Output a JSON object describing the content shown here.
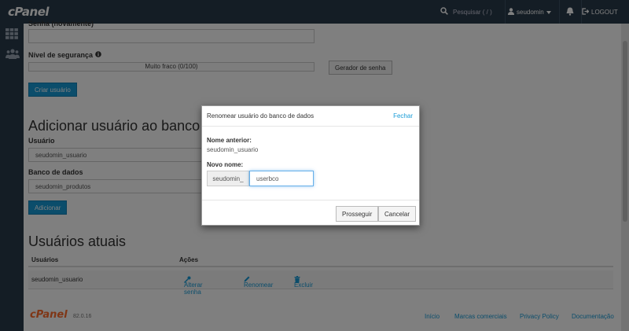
{
  "topbar": {
    "logo": "cPanel",
    "search_placeholder": "Pesquisar ( / )",
    "username": "seudomin",
    "logout_label": "LOGOUT"
  },
  "sidenav": {
    "items": [
      {
        "icon": "grid-icon"
      },
      {
        "icon": "users-icon"
      }
    ]
  },
  "form": {
    "password_again_label": "Senha (novamente)",
    "strength_label": "Nível de segurança",
    "strength_value": "Muito fraco (0/100)",
    "generator_button": "Gerador de senha",
    "create_user_button": "Criar usuário"
  },
  "add_user_section": {
    "title": "Adicionar usuário ao banco de dados",
    "user_label": "Usuário",
    "user_value": "seudomin_usuario",
    "db_label": "Banco de dados",
    "db_value": "seudomin_produtos",
    "add_button": "Adicionar"
  },
  "current_users": {
    "title": "Usuários atuais",
    "columns": [
      "Usuários",
      "Ações"
    ],
    "rows": [
      {
        "user": "seudomin_usuario",
        "actions": [
          "Alterar senha",
          "Renomear",
          "Excluir"
        ]
      }
    ]
  },
  "footer": {
    "logo": "cPanel",
    "version": "82.0.16",
    "links": [
      "Início",
      "Marcas comerciais",
      "Privacy Policy",
      "Documentação"
    ]
  },
  "modal": {
    "title": "Renomear usuário do banco de dados",
    "close_label": "Fechar",
    "old_name_label": "Nome anterior:",
    "old_name_value": "seudomin_usuario",
    "new_name_label": "Novo nome:",
    "prefix": "seudomin_",
    "new_name_value": "userbco",
    "proceed_button": "Prosseguir",
    "cancel_button": "Cancelar"
  },
  "colors": {
    "topbar": "#293a4a",
    "accent": "#179bd7",
    "footer_logo": "#ff6c2c"
  }
}
